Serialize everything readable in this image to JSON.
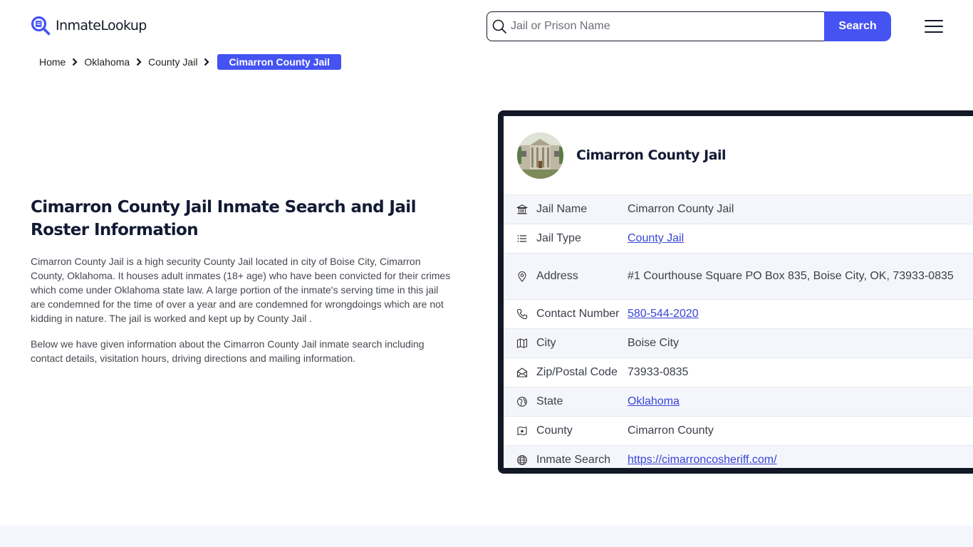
{
  "header": {
    "logo_text": "InmateLookup",
    "search": {
      "placeholder": "Jail or Prison Name",
      "value": "",
      "button_label": "Search"
    },
    "menu_icon": "hamburger-menu-icon"
  },
  "breadcrumb": {
    "items": [
      {
        "label": "Home"
      },
      {
        "label": "Oklahoma"
      },
      {
        "label": "County Jail"
      }
    ],
    "current": "Cimarron County Jail"
  },
  "intro": {
    "title": "Cimarron County Jail Inmate Search and Jail Roster Information",
    "paragraphs": [
      "Cimarron County Jail is a high security County Jail located in city of Boise City, Cimarron County, Oklahoma. It houses adult inmates (18+ age) who have been convicted for their crimes which come under Oklahoma state law. A large portion of the inmate's serving time in this jail are condemned for the time of over a year and are condemned for wrongdoings which are not kidding in nature. The jail is worked and kept up by County Jail .",
      "Below we have given information about the Cimarron County Jail inmate search including contact details, visitation hours, driving directions and mailing information."
    ]
  },
  "card": {
    "title": "Cimarron County Jail",
    "rows": [
      {
        "icon": "bank-building-icon",
        "label": "Jail Name",
        "value": "Cimarron County Jail",
        "link": false
      },
      {
        "icon": "list-icon",
        "label": "Jail Type",
        "value": "County Jail",
        "link": true
      },
      {
        "icon": "map-pin-icon",
        "label": "Address",
        "value": "#1 Courthouse Square PO Box 835, Boise City, OK, 73933-0835",
        "link": false
      },
      {
        "icon": "phone-icon",
        "label": "Contact Number",
        "value": "580-544-2020",
        "link": true
      },
      {
        "icon": "map-icon",
        "label": "City",
        "value": "Boise City",
        "link": false
      },
      {
        "icon": "mail-open-icon",
        "label": "Zip/Postal Code",
        "value": "73933-0835",
        "link": false
      },
      {
        "icon": "globe-region-icon",
        "label": "State",
        "value": "Oklahoma",
        "link": true
      },
      {
        "icon": "map-location-icon",
        "label": "County",
        "value": "Cimarron County",
        "link": false
      },
      {
        "icon": "world-icon",
        "label": "Inmate Search",
        "value": "https://cimarroncosheriff.com/",
        "link": true
      }
    ]
  },
  "colors": {
    "accent": "#4553f2",
    "card_border": "#121826",
    "link": "#3745d6",
    "row_alt_bg": "#f5f6fc"
  }
}
